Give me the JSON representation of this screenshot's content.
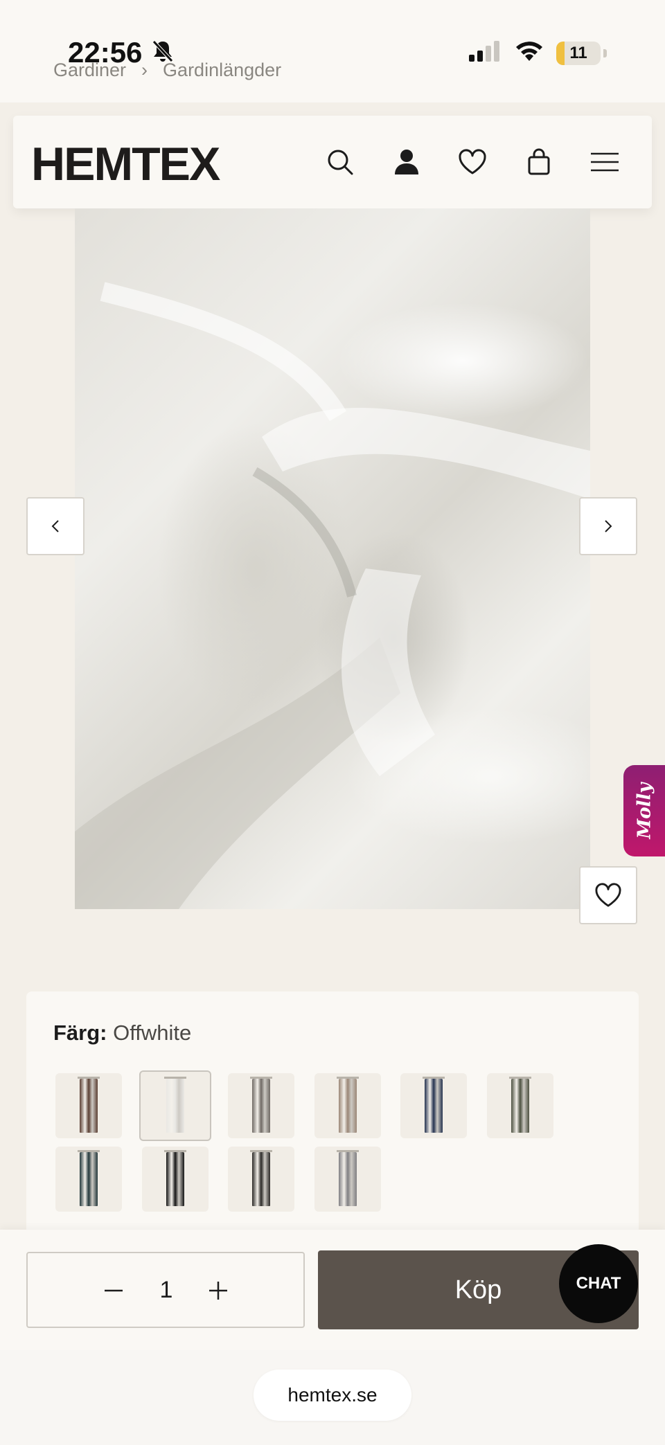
{
  "status_bar": {
    "time": "22:56",
    "battery": "11",
    "icons": [
      "bell-slash-icon",
      "cellular-signal-icon",
      "wifi-icon",
      "battery-icon"
    ]
  },
  "breadcrumb": {
    "items": [
      "Gardiner",
      "Gardinlängder"
    ],
    "separator": "›"
  },
  "header": {
    "logo": "HEMTEX",
    "icons": [
      "search-icon",
      "account-icon",
      "heart-icon",
      "bag-icon",
      "menu-icon"
    ]
  },
  "gallery": {
    "prev_icon": "chevron-left-icon",
    "next_icon": "chevron-right-icon",
    "wishlist_icon": "heart-icon"
  },
  "molly": {
    "label": "Molly"
  },
  "color_selector": {
    "label": "Färg:",
    "selected": "Offwhite",
    "swatches": [
      {
        "color": "#5a3e32"
      },
      {
        "color": "#e9e8e4",
        "selected": true
      },
      {
        "color": "#6f6964"
      },
      {
        "color": "#9a8676"
      },
      {
        "color": "#24324f"
      },
      {
        "color": "#4c5040"
      },
      {
        "color": "#22363a"
      },
      {
        "color": "#141414"
      },
      {
        "color": "#2a2826"
      },
      {
        "color": "#7f7e82"
      }
    ]
  },
  "purchase": {
    "quantity": "1",
    "buy_label": "Köp",
    "chat_label": "CHAT"
  },
  "browser": {
    "url": "hemtex.se"
  },
  "colors": {
    "background": "#f3efe8",
    "buy_button": "#5b534c",
    "molly": "#b0186c"
  }
}
